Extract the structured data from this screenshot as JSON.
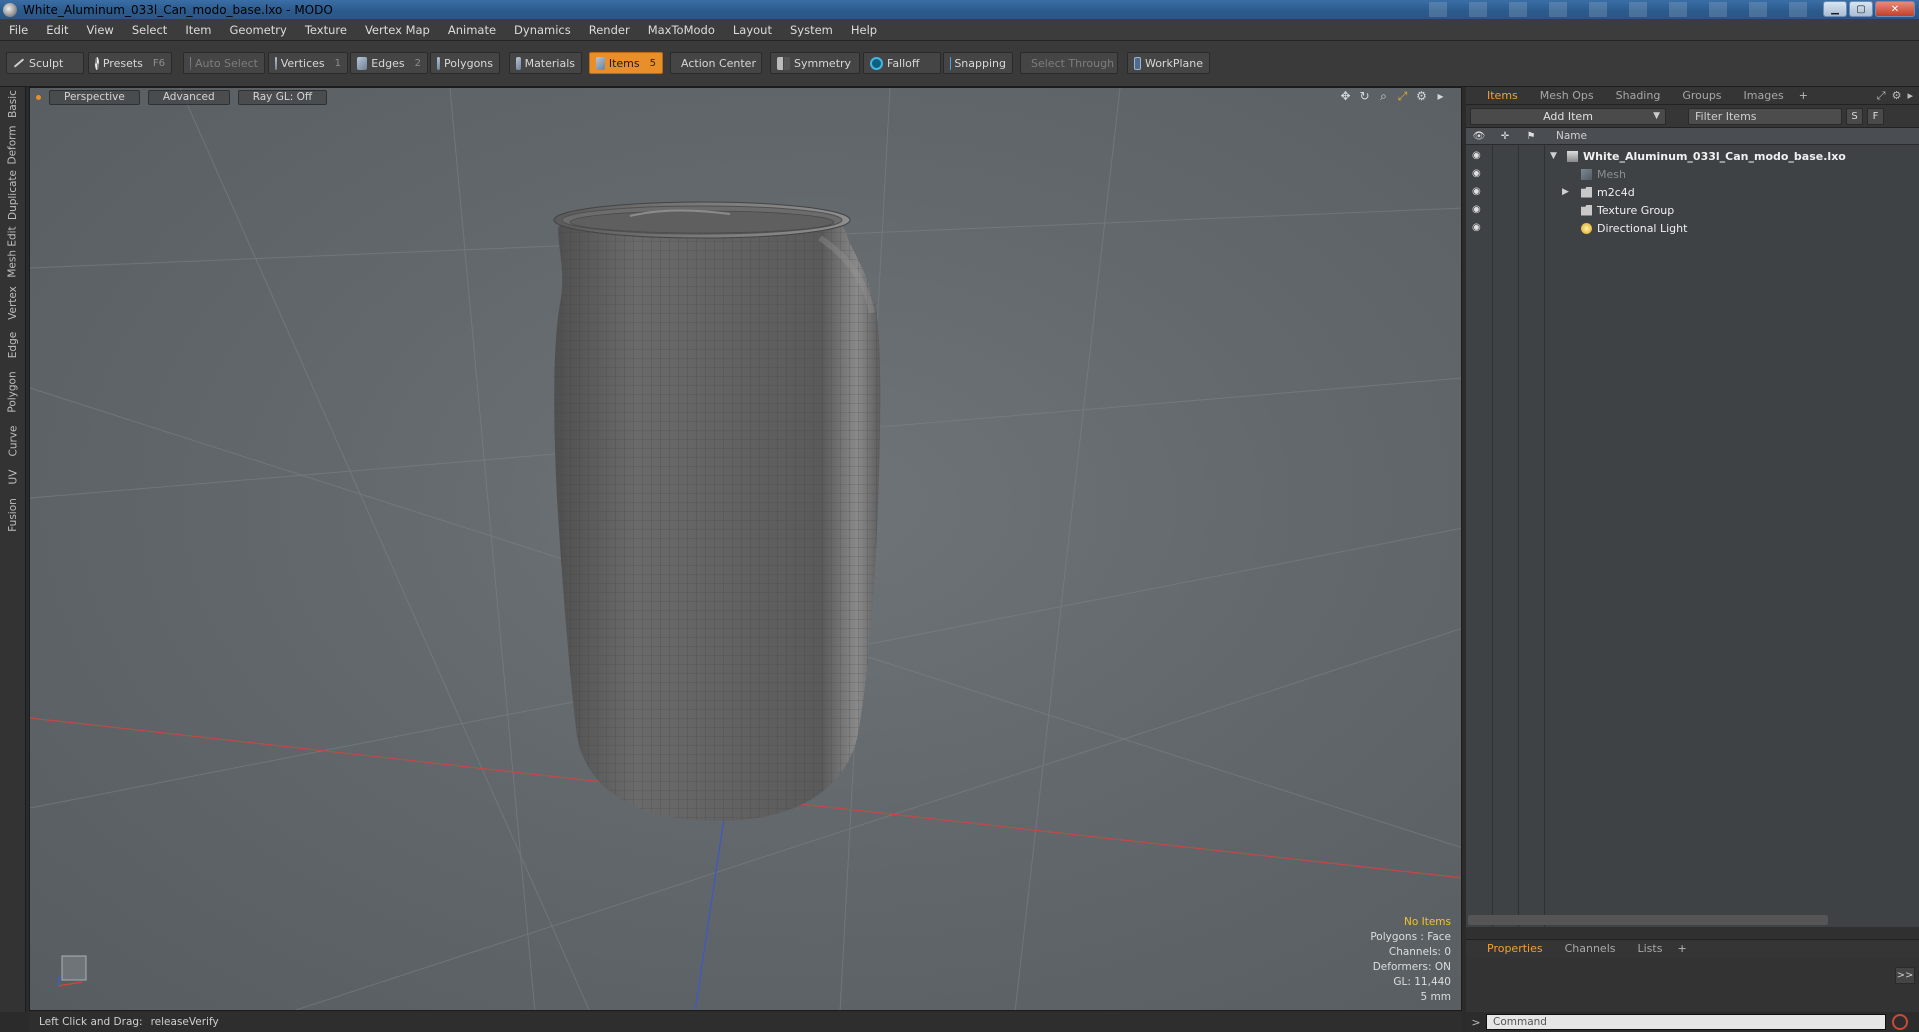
{
  "window": {
    "title": "White_Aluminum_033l_Can_modo_base.lxo - MODO",
    "minimize": "▁",
    "maximize": "▢",
    "close": "✕"
  },
  "menu": [
    "File",
    "Edit",
    "View",
    "Select",
    "Item",
    "Geometry",
    "Texture",
    "Vertex Map",
    "Animate",
    "Dynamics",
    "Render",
    "MaxToModo",
    "Layout",
    "System",
    "Help"
  ],
  "toolbar": {
    "sculpt": "Sculpt",
    "presets": "Presets",
    "presets_key": "F6",
    "auto_select": "Auto Select",
    "vertices": "Vertices",
    "vertices_key": "1",
    "edges": "Edges",
    "edges_key": "2",
    "polygons": "Polygons",
    "materials": "Materials",
    "items": "Items",
    "items_key": "5",
    "action_center": "Action Center",
    "symmetry": "Symmetry",
    "falloff": "Falloff",
    "snapping": "Snapping",
    "select_through": "Select Through",
    "workplane": "WorkPlane"
  },
  "left_tabs": [
    "Basic",
    "Deform",
    "Duplicate",
    "Mesh Edit",
    "Vertex",
    "Edge",
    "Polygon",
    "Curve",
    "UV",
    "Fusion"
  ],
  "viewport": {
    "tabs": [
      "Perspective",
      "Advanced",
      "Ray GL: Off"
    ],
    "info": {
      "selection": "No Items",
      "polygons": "Polygons : Face",
      "channels": "Channels: 0",
      "deformers": "Deformers: ON",
      "gl": "GL: 11,440",
      "scale": "5 mm"
    }
  },
  "status": {
    "hint_label": "Left Click and Drag:",
    "hint_value": "releaseVerify"
  },
  "items_panel": {
    "tabs": [
      "Items",
      "Mesh Ops",
      "Shading",
      "Groups",
      "Images"
    ],
    "active_tab": "Items",
    "add_item": "Add Item",
    "filter_placeholder": "Filter Items",
    "btn_s": "S",
    "btn_f": "F",
    "column_name": "Name",
    "tree": [
      {
        "label": "White_Aluminum_033l_Can_modo_base.lxo",
        "level": 0,
        "expanded": true,
        "type": "scene",
        "style": "bold"
      },
      {
        "label": "Mesh",
        "level": 1,
        "expanded": false,
        "type": "mesh",
        "style": "dim"
      },
      {
        "label": "m2c4d",
        "level": 1,
        "expanded": false,
        "type": "group",
        "style": "normal",
        "has_children": true
      },
      {
        "label": "Texture Group",
        "level": 1,
        "expanded": false,
        "type": "group",
        "style": "normal"
      },
      {
        "label": "Directional Light",
        "level": 1,
        "expanded": false,
        "type": "light",
        "style": "normal"
      }
    ]
  },
  "properties_panel": {
    "tabs": [
      "Properties",
      "Channels",
      "Lists"
    ],
    "active_tab": "Properties",
    "expand": ">>"
  },
  "command": {
    "prompt": ">",
    "placeholder": "Command"
  },
  "colors": {
    "accent": "#e88f2a",
    "viewport_bg": "#62686c",
    "tab_active": "#f2a134",
    "info_warning": "#f2c22e"
  }
}
